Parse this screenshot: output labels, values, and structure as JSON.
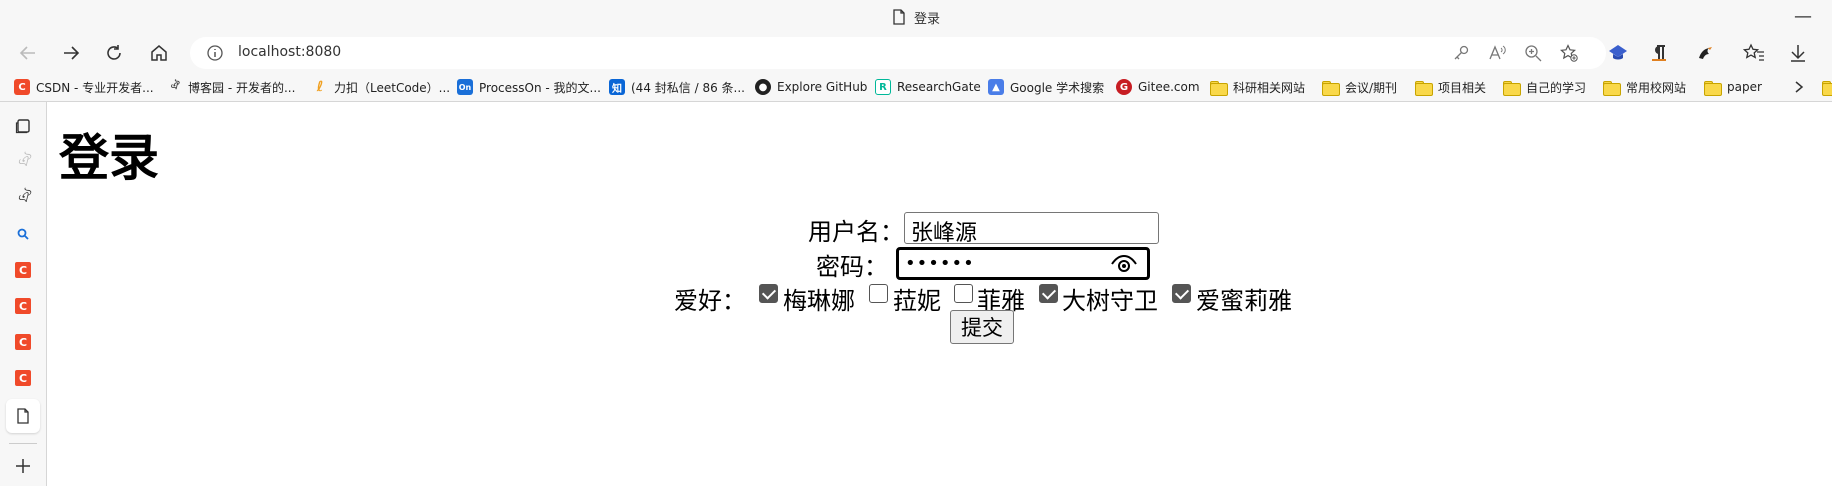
{
  "window": {
    "title": "登录"
  },
  "address_bar": {
    "url": "localhost:8080"
  },
  "bookmarks": [
    {
      "label": "CSDN - 专业开发者...",
      "icon": "csdn-icon"
    },
    {
      "label": "博客园 - 开发者的...",
      "icon": "cnblogs-icon"
    },
    {
      "label": "力扣（LeetCode）...",
      "icon": "leetcode-icon"
    },
    {
      "label": "ProcessOn - 我的文...",
      "icon": "processon-icon"
    },
    {
      "label": "(44 封私信 / 86 条...",
      "icon": "zhihu-icon"
    },
    {
      "label": "Explore GitHub",
      "icon": "github-icon"
    },
    {
      "label": "ResearchGate",
      "icon": "researchgate-icon"
    },
    {
      "label": "Google 学术搜索",
      "icon": "google-scholar-icon"
    },
    {
      "label": "Gitee.com",
      "icon": "gitee-icon"
    },
    {
      "label": "科研相关网站",
      "icon": "folder-icon"
    },
    {
      "label": "会议/期刊",
      "icon": "folder-icon"
    },
    {
      "label": "项目相关",
      "icon": "folder-icon"
    },
    {
      "label": "自己的学习",
      "icon": "folder-icon"
    },
    {
      "label": "常用校网站",
      "icon": "folder-icon"
    },
    {
      "label": "paper",
      "icon": "folder-icon"
    }
  ],
  "page": {
    "heading": "登录",
    "username_label": "用户名：",
    "username_value": "张峰源",
    "password_label": "密码：",
    "password_masked": "••••••",
    "hobbies_label": "爱好：",
    "hobbies": [
      {
        "label": "梅琳娜",
        "checked": true
      },
      {
        "label": "菈妮",
        "checked": false
      },
      {
        "label": "菲雅",
        "checked": false
      },
      {
        "label": "大树守卫",
        "checked": true
      },
      {
        "label": "爱蜜莉雅",
        "checked": true
      }
    ],
    "submit_label": "提交"
  },
  "colors": {
    "csdn": "#f04a2a",
    "checkbox_checked": "#555555"
  }
}
